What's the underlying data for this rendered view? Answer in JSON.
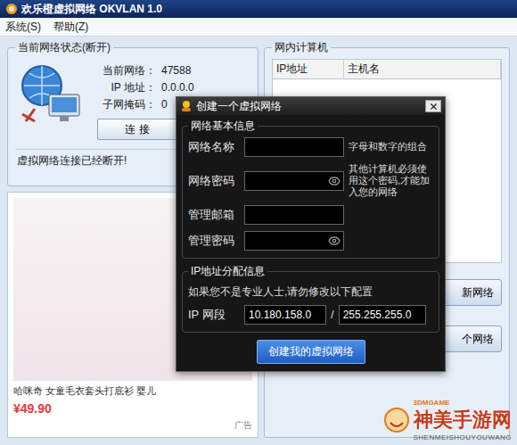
{
  "window": {
    "title": "欢乐橙虚拟网络 OKVLAN 1.0"
  },
  "menu": [
    "系统(S)",
    "帮助(Z)"
  ],
  "status_panel": {
    "title": "当前网络状态(断开)",
    "fields": [
      {
        "label": "当前网络：",
        "value": "47588"
      },
      {
        "label": "IP 地址：",
        "value": "0.0.0.0"
      },
      {
        "label": "子网掩码：",
        "value": "0"
      }
    ],
    "connect_button": "连 接",
    "message": "虚拟网络连接已经断开!"
  },
  "ad": {
    "title": "哈咪奇 女童毛衣套头打底衫 婴儿",
    "price": "¥49.90",
    "tag": "广告"
  },
  "computers": {
    "title": "网内计算机",
    "columns": [
      "IP地址",
      "主机名"
    ]
  },
  "side_buttons": [
    "新网络",
    "个网络"
  ],
  "dialog": {
    "title": "创建一个虚拟网络",
    "basic_section": {
      "title": "网络基本信息",
      "fields": [
        {
          "label": "网络名称",
          "kind": "text",
          "hint": "字母和数字的组合"
        },
        {
          "label": "网络密码",
          "kind": "password",
          "hint": "其他计算机必须使用这个密码,才能加入您的网络"
        },
        {
          "label": "管理邮箱",
          "kind": "text"
        },
        {
          "label": "管理密码",
          "kind": "password"
        }
      ]
    },
    "ip_section": {
      "title": "IP地址分配信息",
      "note": "如果您不是专业人士,请勿修改以下配置",
      "label": "IP 网段",
      "network": "10.180.158.0",
      "separator": "/",
      "mask": "255.255.255.0"
    },
    "submit": "创建我的虚拟网络"
  },
  "watermark": {
    "name": "神美手游网",
    "pinyin": "SHENMEISHOUYOUWANG",
    "brand": "3DMGAME"
  }
}
